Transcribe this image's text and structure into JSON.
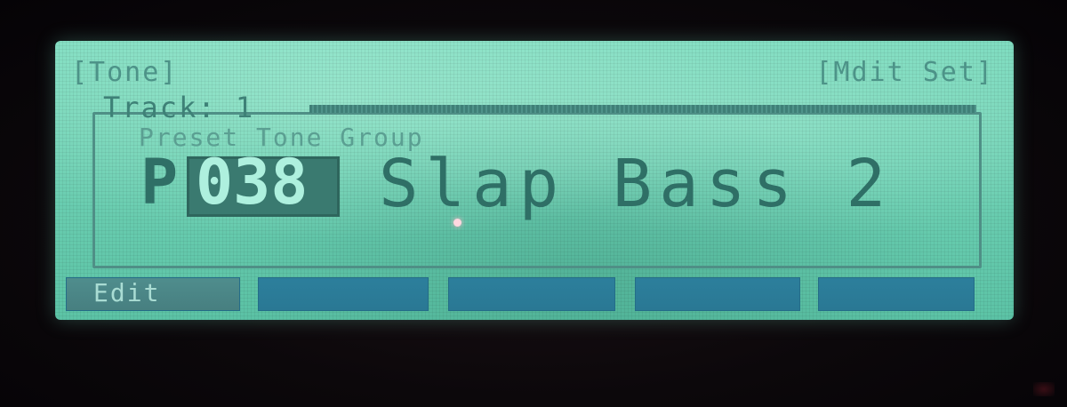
{
  "screen": {
    "title": "[Tone]",
    "mode": "[Mdit Set]"
  },
  "track": {
    "label": "Track: 1"
  },
  "tone": {
    "group": "Preset Tone Group",
    "prefix": "P",
    "number": "038",
    "name": "Slap Bass 2"
  },
  "function_keys": [
    {
      "label": "Edit",
      "active": true
    },
    {
      "label": "",
      "active": false
    },
    {
      "label": "",
      "active": false
    },
    {
      "label": "",
      "active": false
    },
    {
      "label": "",
      "active": false
    }
  ],
  "colors": {
    "lcd_background": "#6fd1b4",
    "lcd_text": "#2f6f66",
    "function_key": "#2c7f9c",
    "function_key_active": "#4f8d8d"
  }
}
